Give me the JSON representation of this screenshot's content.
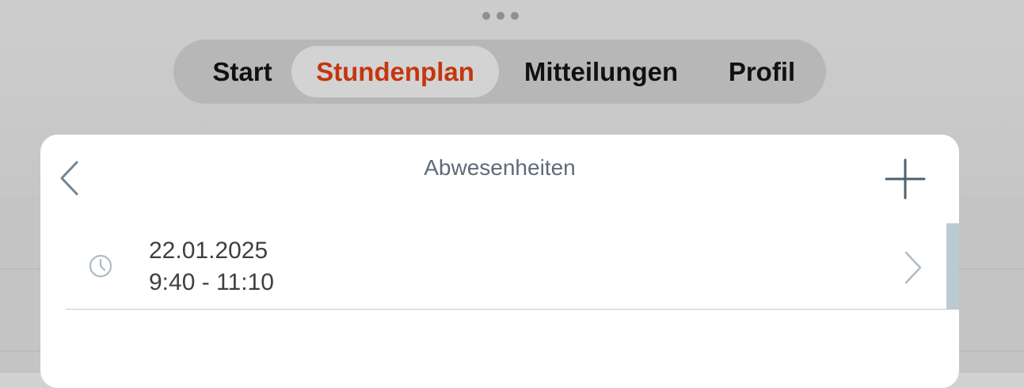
{
  "tabs": [
    {
      "label": "Start",
      "active": false
    },
    {
      "label": "Stundenplan",
      "active": true
    },
    {
      "label": "Mitteilungen",
      "active": false
    },
    {
      "label": "Profil",
      "active": false
    }
  ],
  "accent_color": "#c4360e",
  "sheet": {
    "title": "Abwesenheiten",
    "subtitle": "",
    "back_icon": "chevron-left-icon",
    "add_icon": "plus-icon",
    "items": [
      {
        "date": "22.01.2025",
        "time": "9:40 - 11:10",
        "icon": "clock-icon"
      }
    ]
  }
}
